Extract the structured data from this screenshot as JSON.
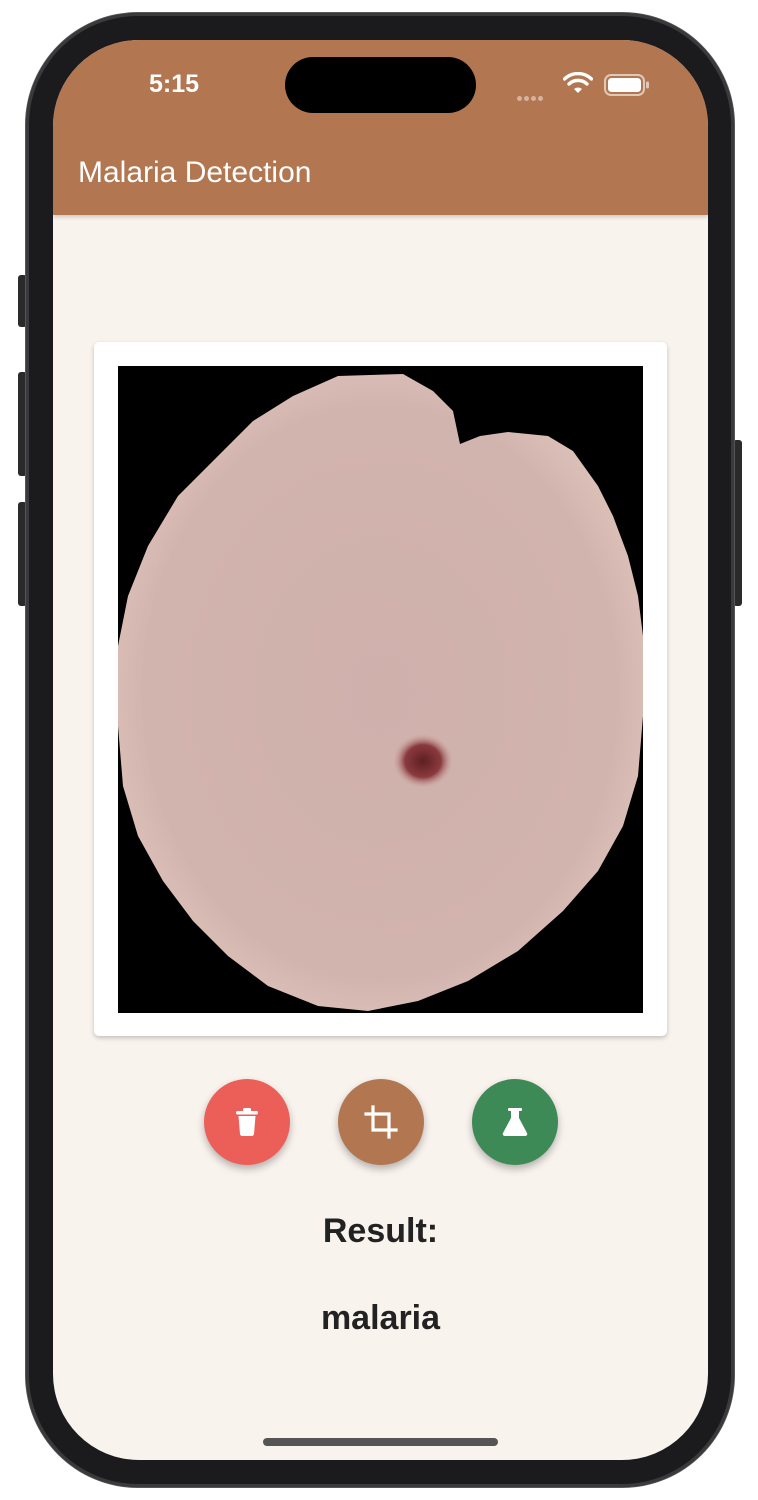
{
  "status_bar": {
    "time": "5:15",
    "icons": [
      "cellular-signal-icon",
      "wifi-icon",
      "battery-icon"
    ]
  },
  "app_bar": {
    "title": "Malaria Detection",
    "color": "#b27650"
  },
  "image_card": {
    "image": "blood-cell-microscope-image"
  },
  "actions": {
    "delete": {
      "icon": "trash-icon",
      "color": "#ec5f58"
    },
    "crop": {
      "icon": "crop-icon",
      "color": "#b27650"
    },
    "detect": {
      "icon": "flask-icon",
      "color": "#3e8a57"
    }
  },
  "result": {
    "label": "Result:",
    "value": "malaria"
  },
  "colors": {
    "background": "#f9f3ee",
    "text": "#222222"
  }
}
